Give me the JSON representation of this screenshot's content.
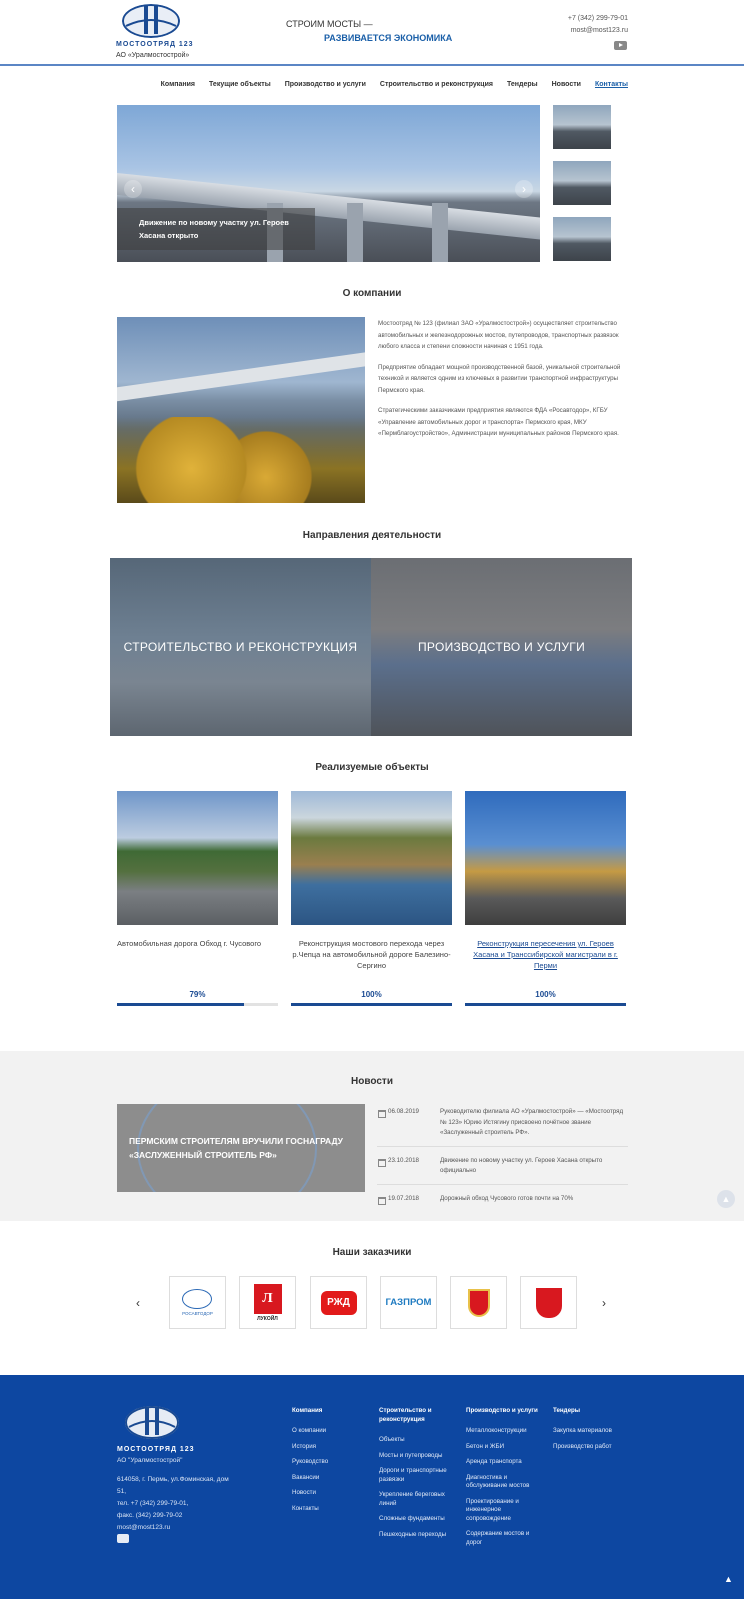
{
  "header": {
    "logo_text": "МОСТООТРЯД 123",
    "logo_sub": "АО «Уралмостострой»",
    "slogan_line1": "СТРОИМ МОСТЫ —",
    "slogan_line2": "РАЗВИВАЕТСЯ ЭКОНОМИКА",
    "phone": "+7 (342) 299-79-01",
    "email": "most@most123.ru"
  },
  "nav": {
    "items": [
      "Компания",
      "Текущие объекты",
      "Производство и услуги",
      "Строительство и реконструкция",
      "Тендеры",
      "Новости",
      "Контакты"
    ],
    "active": "Контакты"
  },
  "slider": {
    "caption": "Движение по новому участку ул. Героев Хасана открыто",
    "prev": "‹",
    "next": "›"
  },
  "about": {
    "title": "О компании",
    "paragraphs": [
      "Мостоотряд № 123 (филиал ЗАО «Уралмостострой») осуществляет строительство автомобильных и железнодорожных мостов, путепроводов, транспортных развязок любого класса и степени сложности начиная с 1951 года.",
      "Предприятие обладает мощной производственной базой, уникальной строительной техникой и является одним из ключевых в развитии транспортной инфраструктуры Пермского края.",
      "Стратегическими заказчиками предприятия являются ФДА «Росавтодор», КГБУ «Управление автомобильных дорог и транспорта» Пермского края, МКУ «Пермблагоустройство», Администрации муниципальных районов Пермского края."
    ]
  },
  "directions": {
    "title": "Направления деятельности",
    "items": [
      "СТРОИТЕЛЬСТВО И РЕКОНСТРУКЦИЯ",
      "ПРОИЗВОДСТВО И УСЛУГИ"
    ]
  },
  "objects": {
    "title": "Реализуемые объекты",
    "items": [
      {
        "caption": "Автомобильная дорога Обход г. Чусового",
        "percent_label": "79%",
        "progress": 0.79
      },
      {
        "caption": "Реконструкция мостового перехода через р.Чепца на автомобильной дороге Балезино-Сергино",
        "percent_label": "100%",
        "progress": 1.0
      },
      {
        "caption": "Реконструкция пересечения ул. Героев Хасана и Транссибирской магистрали в г. Перми",
        "percent_label": "100%",
        "progress": 1.0
      }
    ]
  },
  "news": {
    "title": "Новости",
    "featured": "ПЕРМСКИМ СТРОИТЕЛЯМ ВРУЧИЛИ ГОСНАГРАДУ «ЗАСЛУЖЕННЫЙ СТРОИТЕЛЬ РФ»",
    "items": [
      {
        "date": "06.08.2019",
        "text": "Руководителю филиала АО «Уралмостострой» — «Мостоотряд № 123» Юрию Истягину присвоено почётное звание «Заслуженный строитель РФ»."
      },
      {
        "date": "23.10.2018",
        "text": "Движение по новому участку ул. Героев Хасана открыто официально"
      },
      {
        "date": "19.07.2018",
        "text": "Дорожный обход Чусового готов почти на 70%"
      }
    ]
  },
  "clients": {
    "title": "Наши заказчики",
    "logos": [
      {
        "icon": "rosavtodor-logo",
        "text": "РОСАВТОДОР"
      },
      {
        "icon": "lukoil-logo",
        "text": "ЛУКОЙЛ"
      },
      {
        "icon": "rzd-logo",
        "text": "РЖД"
      },
      {
        "icon": "gazprom-logo",
        "text": "ГАЗПРОМ"
      },
      {
        "icon": "perm-krai-emblem",
        "text": ""
      },
      {
        "icon": "perm-city-emblem",
        "text": ""
      }
    ],
    "prev": "‹",
    "next": "›"
  },
  "footer": {
    "logo_text": "МОСТООТРЯД 123",
    "logo_sub": "АО \"Уралмостострой\"",
    "address": "614058, г. Пермь, ул.Фоминская, дом 51,",
    "tel": "тел. +7 (342) 299-79-01,",
    "fax": "факс. (342) 299-79-02",
    "email": "most@most123.ru",
    "columns": [
      {
        "heading": "Компания",
        "items": [
          "О компании",
          "История",
          "Руководство",
          "Вакансии",
          "Новости",
          "Контакты"
        ]
      },
      {
        "heading": "Строительство и реконструкция",
        "items": [
          "Объекты",
          "Мосты и путепроводы",
          "Дороги и транспортные развязки",
          "Укрепление береговых линий",
          "Сложные фундаменты",
          "Пешеходные переходы"
        ]
      },
      {
        "heading": "Производство и услуги",
        "items": [
          "Металлоконструкции",
          "Бетон и ЖБИ",
          "Аренда транспорта",
          "Диагностика и обслуживание мостов",
          "Проектирование и инженерное сопровождение",
          "Содержание мостов и дорог"
        ]
      },
      {
        "heading": "Тендеры",
        "items": [
          "Закупка материалов",
          "Производство работ"
        ]
      }
    ]
  },
  "colors": {
    "brand": "#0d47a1",
    "link": "#1a5fa8",
    "news_bg": "#f2f2f2"
  }
}
